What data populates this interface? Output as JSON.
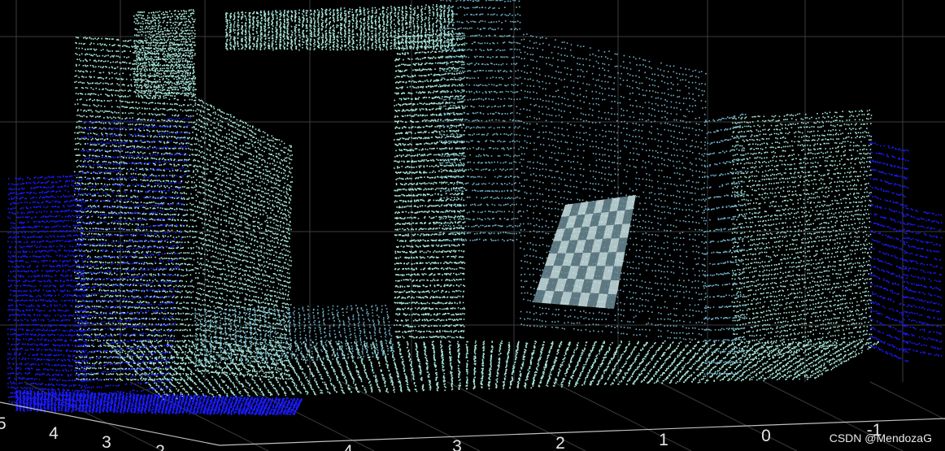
{
  "chart_data": {
    "type": "scatter",
    "subtype": "3d-point-cloud",
    "title": "",
    "xlabel": "",
    "ylabel": "",
    "zlabel": "",
    "grid": true,
    "background": "#000000",
    "x_axis_ticks": [
      "4",
      "3",
      "2",
      "1",
      "0",
      "-1"
    ],
    "y_axis_ticks": [
      "5",
      "4",
      "3",
      "2"
    ],
    "colors": {
      "near_points": "#1a1aff",
      "far_points": "#a8e6d8",
      "mid_points": "#6fb0c8",
      "checkerboard_light": "#cfe8ea",
      "checkerboard_dark": "#6d8d98",
      "grid": "#3c3c3c",
      "axis_text": "#e6e6e6"
    }
  },
  "watermark": "CSDN @MendozaG"
}
